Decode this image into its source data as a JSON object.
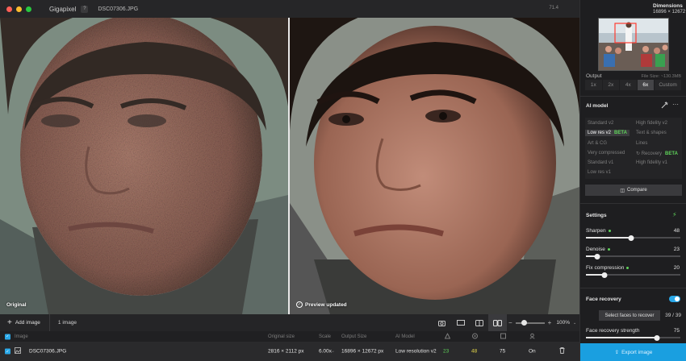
{
  "app": {
    "title": "Gigapixel",
    "title_badge": "?",
    "file": "DSC07306.JPG",
    "zoom_readout": "71.4"
  },
  "viewer": {
    "left_label": "Original",
    "right_label": "Preview updated"
  },
  "toolbar": {
    "add_image": "Add image",
    "image_count": "1 image",
    "zoom": "100%",
    "zoom_level": 0.25
  },
  "table": {
    "headers": [
      "Image",
      "Original size",
      "Scale",
      "Output Size",
      "AI Model"
    ],
    "row": {
      "name": "DSC07306.JPG",
      "original_size": "2816 × 2112 px",
      "scale": "6.00x",
      "output_size": "16896 × 12672 px",
      "model": "Low resolution v2",
      "sharpen": "23",
      "denoise": "48",
      "fix": "75",
      "face": "On"
    }
  },
  "sidebar": {
    "dimensions_label": "Dimensions",
    "dimensions_value": "16896 × 12672",
    "output_label": "Output",
    "file_size": "File Size: ~130.3MB",
    "scales": [
      "1x",
      "2x",
      "4x",
      "6x",
      "Custom"
    ],
    "active_scale": "6x",
    "ai_model_title": "AI model",
    "models": {
      "standard_v2": "Standard v2",
      "high_fidelity_v2": "High fidelity v2",
      "low_res_v2": "Low res v2",
      "beta1": "BETA",
      "text_shapes": "Text & shapes",
      "art_cg": "Art & CG",
      "lines": "Lines",
      "very_compressed": "Very compressed",
      "recovery": "Recovery",
      "beta2": "BETA",
      "standard_v1": "Standard v1",
      "high_fidelity_v1": "High fidelity v1",
      "low_res_v1": "Low res v1"
    },
    "compare": "Compare",
    "settings_title": "Settings",
    "sliders": [
      {
        "label": "Sharpen",
        "value": "48",
        "level": 0.48
      },
      {
        "label": "Denoise",
        "value": "23",
        "level": 0.12
      },
      {
        "label": "Fix compression",
        "value": "20",
        "level": 0.2
      }
    ],
    "face_recovery_title": "Face recovery",
    "select_faces": "Select faces to recover",
    "face_count": "39 / 39",
    "face_strength_label": "Face recovery strength",
    "face_strength_value": "75",
    "face_strength_level": 0.75,
    "export": "Export image"
  },
  "colors": {
    "accent": "#1a9fe0",
    "beta_green": "#5fd35a"
  }
}
